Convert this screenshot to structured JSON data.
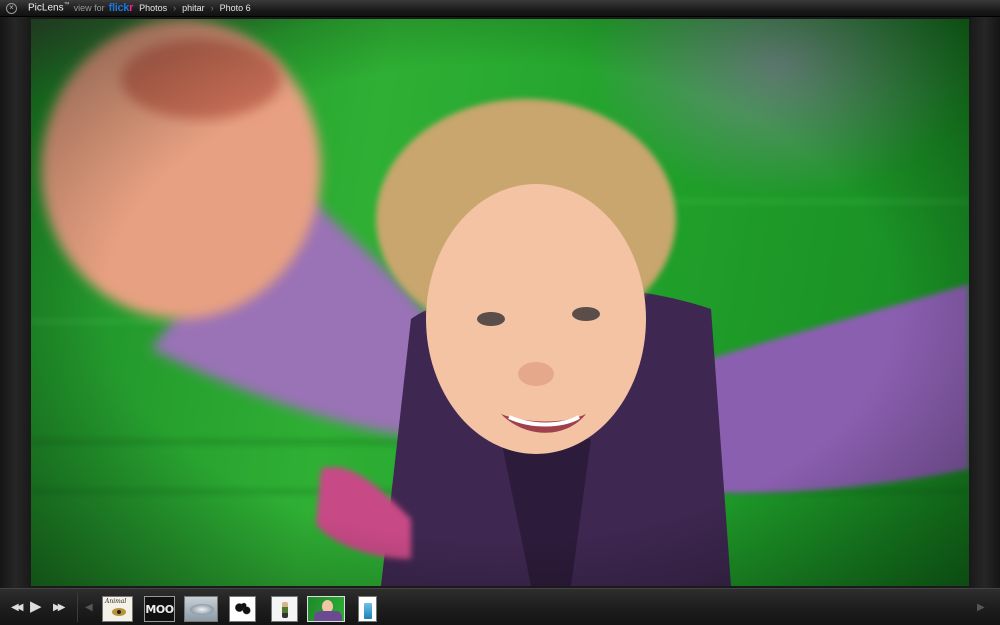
{
  "topbar": {
    "close_glyph": "×",
    "app_name": "PicLens",
    "trademark": "™",
    "view_for": "view for",
    "service_a": "flick",
    "service_b": "r",
    "breadcrumb": [
      {
        "label": "Photos"
      },
      {
        "label": "phitar"
      },
      {
        "label": "Photo 6"
      }
    ],
    "breadcrumb_separator": "›"
  },
  "photo": {
    "subject": "photo-of-child-spinning"
  },
  "controls": {
    "prev_glyph": "◀◀",
    "play_glyph": "▶",
    "next_glyph": "▶▶",
    "strip_left_glyph": "◀",
    "strip_right_glyph": "▶"
  },
  "thumbnails": [
    {
      "name": "thumb-animal-book",
      "title": "Animal"
    },
    {
      "name": "thumb-moo",
      "label": "MOO"
    },
    {
      "name": "thumb-silver-disc"
    },
    {
      "name": "thumb-ink-blot"
    },
    {
      "name": "thumb-figure"
    },
    {
      "name": "thumb-child-grass",
      "selected": true
    },
    {
      "name": "thumb-blue-bottle"
    }
  ],
  "colors": {
    "flickr_blue": "#1e74d8",
    "flickr_pink": "#ff1f8f",
    "grass": "#2fb034",
    "sweater": "#8a5fae"
  }
}
